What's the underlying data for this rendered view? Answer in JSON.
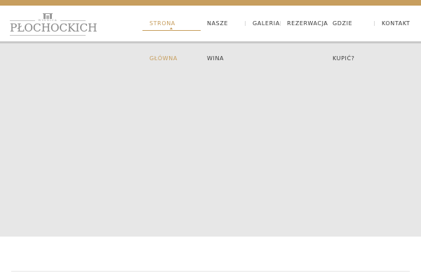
{
  "logo": {
    "small_text": "WINNICA",
    "main_text": "PŁOCHOCKICH",
    "mark_icon": "castle-gate-icon"
  },
  "nav": {
    "items": [
      {
        "label": "STRONA",
        "sub": "GŁÓWNA",
        "active": true
      },
      {
        "label": "NASZE",
        "sub": "WINA",
        "active": false
      },
      {
        "label": "GALERIA",
        "sub": "",
        "active": false
      },
      {
        "label": "REZERWACJA",
        "sub": "",
        "active": false
      },
      {
        "label": "GDZIE",
        "sub": "KUPIĆ?",
        "active": false
      },
      {
        "label": "KONTAKT",
        "sub": "",
        "active": false
      }
    ]
  },
  "colors": {
    "accent": "#c79e5e",
    "text": "#3a3a3a",
    "dropdown_bg": "#e7e7e7"
  }
}
